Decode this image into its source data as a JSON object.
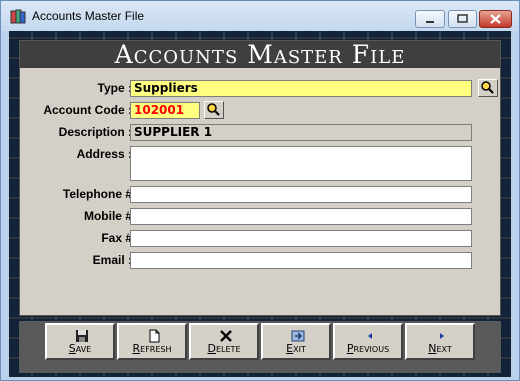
{
  "window": {
    "title": "Accounts Master File",
    "icon": "app-icon",
    "controls": {
      "minimize": "minimize-icon",
      "maximize": "maximize-icon",
      "close": "close-icon"
    }
  },
  "form": {
    "header": "Accounts Master File",
    "fields": {
      "type": {
        "label": "Type :",
        "value": "Suppliers"
      },
      "account_code": {
        "label": "Account Code :",
        "value": "102001"
      },
      "description": {
        "label": "Description :",
        "value": "SUPPLIER 1"
      },
      "address": {
        "label": "Address :",
        "value": ""
      },
      "telephone": {
        "label": "Telephone #",
        "value": ""
      },
      "mobile": {
        "label": "Mobile #",
        "value": ""
      },
      "fax": {
        "label": "Fax #",
        "value": ""
      },
      "email": {
        "label": "Email :",
        "value": ""
      }
    }
  },
  "toolbar": {
    "save": {
      "label": "Save",
      "icon": "save-icon"
    },
    "refresh": {
      "label": "Refresh",
      "icon": "document-icon"
    },
    "delete": {
      "label": "Delete",
      "icon": "delete-x-icon"
    },
    "exit": {
      "label": "Exit",
      "icon": "exit-icon"
    },
    "previous": {
      "label": "Previous",
      "icon": "arrow-left-icon"
    },
    "next": {
      "label": "Next",
      "icon": "arrow-right-icon"
    }
  },
  "colors": {
    "header_bg": "#3f3f3f",
    "type_field_bg": "#ffff80",
    "account_code_text": "#ff0000",
    "toolbar_bg": "#5a5a5a"
  }
}
